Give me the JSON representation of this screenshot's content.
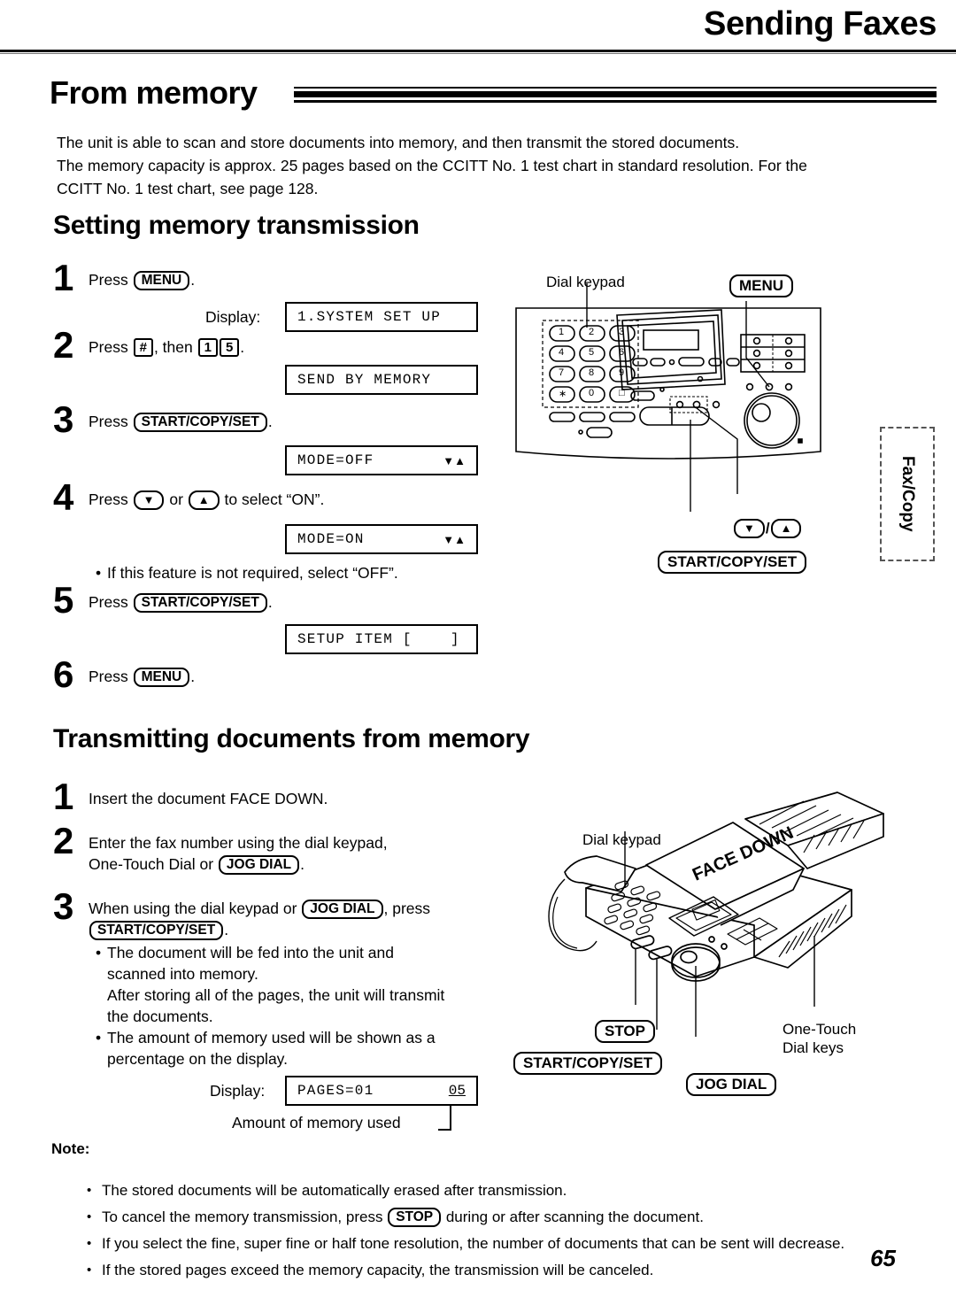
{
  "header": {
    "chapter_title": "Sending Faxes"
  },
  "section": {
    "title": "From memory",
    "intro_line1": "The unit is able to scan and store documents into memory, and then transmit the stored documents.",
    "intro_line2": "The memory capacity is approx. 25 pages based on the CCITT No. 1 test chart in standard resolution. For the",
    "intro_line3": "CCITT No. 1 test chart, see page 128."
  },
  "setting": {
    "heading": "Setting memory transmission",
    "steps": [
      {
        "num": "1",
        "text_before": "Press ",
        "key": "MENU",
        "text_after": ".",
        "display_label": "Display:",
        "display_text": "1.SYSTEM SET UP"
      },
      {
        "num": "2",
        "text_before": "Press ",
        "key_hash": "#",
        "text_mid": ", then ",
        "key_1": "1",
        "key_5": "5",
        "text_after": ".",
        "display_text": "SEND BY MEMORY"
      },
      {
        "num": "3",
        "text_before": "Press ",
        "key": "START/COPY/SET",
        "text_after": ".",
        "display_text": "MODE=OFF",
        "display_arrows": "▼▲"
      },
      {
        "num": "4",
        "text_before": "Press ",
        "key_down": "▼",
        "text_mid": " or ",
        "key_up": "▲",
        "text_after": " to select “ON”.",
        "display_text": "MODE=ON",
        "display_arrows": "▼▲",
        "note": "If this feature is not required, select “OFF”."
      },
      {
        "num": "5",
        "text_before": "Press ",
        "key": "START/COPY/SET",
        "text_after": ".",
        "display_text": "SETUP ITEM [    ]"
      },
      {
        "num": "6",
        "text_before": "Press ",
        "key": "MENU",
        "text_after": "."
      }
    ]
  },
  "transmitting": {
    "heading": "Transmitting documents from memory",
    "steps": [
      {
        "num": "1",
        "line1": "Insert the document FACE DOWN."
      },
      {
        "num": "2",
        "line1": "Enter the fax number using the dial keypad,",
        "line2_before": "One-Touch Dial or ",
        "key": "JOG DIAL",
        "line2_after": "."
      },
      {
        "num": "3",
        "line1_before": "When using the dial keypad or ",
        "key_jog": "JOG DIAL",
        "line1_after": ", press",
        "key_start": "START/COPY/SET",
        "line2_after": "."
      }
    ],
    "bullets": [
      "The document will be fed into the unit and",
      "scanned into memory.",
      "After storing all of the pages, the unit will transmit",
      "the documents.",
      "The amount of memory used will be shown as a",
      "percentage on the display."
    ],
    "display_label": "Display:",
    "display_pages": "PAGES=01",
    "display_percent": "05",
    "memory_callout": "Amount of memory used"
  },
  "notes": {
    "heading": "Note:",
    "items": [
      "The stored documents will be automatically erased after transmission.",
      "To cancel the memory transmission, press",
      "during or after scanning the document.",
      "If you select the fine, super fine or half tone resolution, the number of documents that can be sent will decrease.",
      "If the stored pages exceed the memory capacity, the transmission will be canceled."
    ],
    "stop_key": "STOP"
  },
  "illustration_top": {
    "dial_keypad_label": "Dial keypad",
    "menu_key": "MENU",
    "start_key": "START/COPY/SET",
    "arrow_key_down": "▼",
    "arrow_key_sep": "/",
    "arrow_key_up": "▲",
    "keypad_keys": [
      "1",
      "2",
      "3",
      "4",
      "5",
      "6",
      "7",
      "8",
      "9",
      "∗",
      "0",
      "□"
    ]
  },
  "illustration_bottom": {
    "dial_keypad_label": "Dial keypad",
    "face_down_label": "FACE DOWN",
    "stop_key": "STOP",
    "start_key": "START/COPY/SET",
    "jog_key": "JOG DIAL",
    "one_touch_line1": "One-Touch",
    "one_touch_line2": "Dial keys"
  },
  "side_tab": {
    "label": "Fax/Copy"
  },
  "footer": {
    "page_number": "65"
  }
}
